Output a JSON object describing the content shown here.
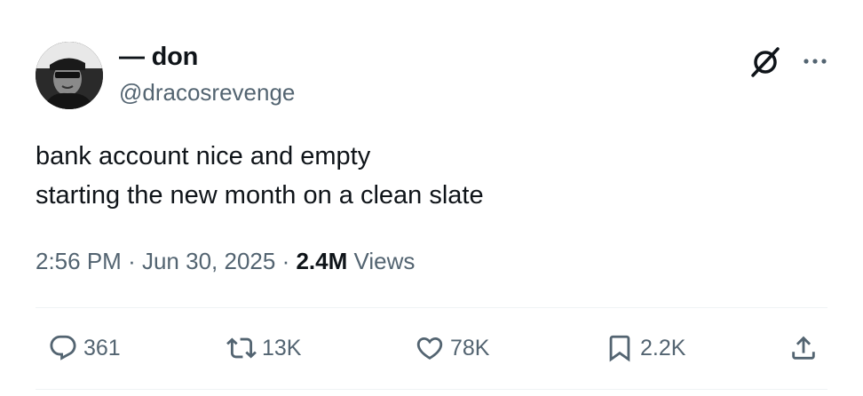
{
  "author": {
    "display_name": "— don",
    "handle": "@dracosrevenge",
    "avatar_icon": "user-avatar-photo"
  },
  "tweet": {
    "lines": [
      "bank account nice and empty",
      "starting the new month on a clean slate"
    ]
  },
  "meta": {
    "time": "2:56 PM",
    "separator": "·",
    "date": "Jun 30, 2025",
    "views_count": "2.4M",
    "views_label": "Views"
  },
  "actions": {
    "reply": {
      "icon": "reply-icon",
      "count": "361"
    },
    "repost": {
      "icon": "repost-icon",
      "count": "13K"
    },
    "like": {
      "icon": "heart-icon",
      "count": "78K"
    },
    "bookmark": {
      "icon": "bookmark-icon",
      "count": "2.2K"
    },
    "share": {
      "icon": "share-icon"
    }
  },
  "header_buttons": {
    "grok": "grok-icon",
    "more": "more-options-icon"
  },
  "colors": {
    "text_primary": "#0f1419",
    "text_secondary": "#536471",
    "divider": "#eff3f4",
    "background": "#ffffff"
  }
}
